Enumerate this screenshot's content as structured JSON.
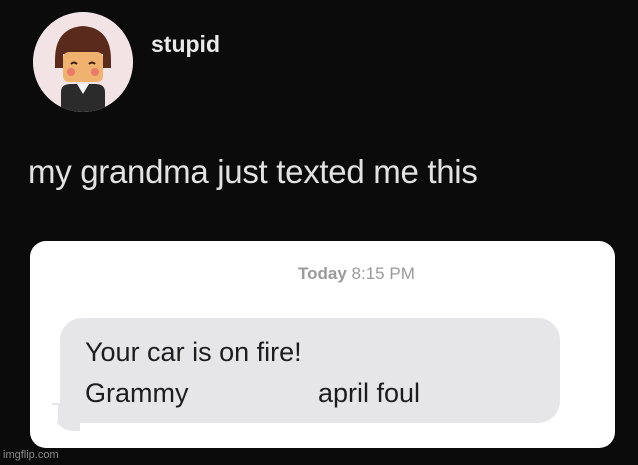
{
  "post": {
    "username": "stupid",
    "text": "my grandma just texted me this"
  },
  "message": {
    "timestamp_day": "Today",
    "timestamp_time": "8:15 PM",
    "line1": "Your car is on fire!",
    "line2_sender": "Grammy",
    "line2_note": "april foul"
  },
  "watermark": "imgflip.com",
  "colors": {
    "background": "#0b0b0b",
    "card": "#ffffff",
    "bubble": "#e6e6e8",
    "timestamp": "#9a9a9a"
  }
}
